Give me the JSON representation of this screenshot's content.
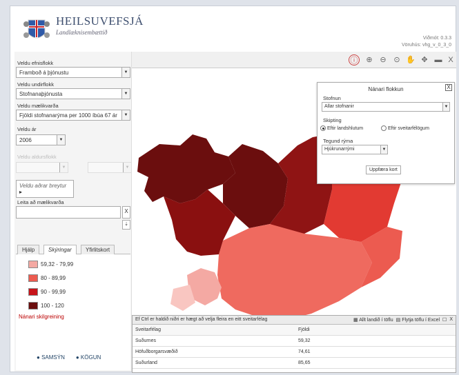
{
  "header": {
    "title": "HEILSUVEFSJÁ",
    "subtitle": "Landlæknisembættið",
    "version_line1": "Viðmót: 0.3.3",
    "version_line2": "Vöruhús: vhg_v_0_3_0"
  },
  "left": {
    "category_label": "Veldu efnisflokk",
    "category_value": "Framboð á þjónustu",
    "subcategory_label": "Veldu undirflokk",
    "subcategory_value": "Stofnanaþjónusta",
    "measure_label": "Veldu mælikvarða",
    "measure_value": "Fjöldi stofnanarýma per 1000 íbúa 67 ár",
    "year_label": "Veldu ár",
    "year_value": "2006",
    "age_label": "Veldu aldursflokk",
    "more_vars": "Veldu aðrar breytur",
    "search_label": "Leita að mælikvarða",
    "search_value": "",
    "tabs": [
      "Hjálp",
      "Skýringar",
      "Yfirlitskort"
    ],
    "legend": [
      {
        "label": "59,32 - 79,99",
        "color": "#f4a9a3"
      },
      {
        "label": "80 - 89,99",
        "color": "#ec5b50"
      },
      {
        "label": "90 - 99,99",
        "color": "#c8141a"
      },
      {
        "label": "100 - 120",
        "color": "#6b0e0e"
      }
    ],
    "nanari": "Nánari skilgreining",
    "footer_samsyn": "SAMSÝN",
    "footer_kogun": "KÖGUN"
  },
  "panel": {
    "title": "Nánari flokkun",
    "stofnun_label": "Stofnun",
    "stofnun_value": "Allar stofnanir",
    "skipting_label": "Skipting",
    "radio1": "Eftir landshlutum",
    "radio2": "Eftir sveitarfélögum",
    "tegund_label": "Tegund rýma",
    "tegund_value": "Hjúkrunarrými",
    "button": "Uppfæra kort"
  },
  "table": {
    "hint": "Ef Ctrl er haldið niðri er hægt að velja fleira en eitt sveitarfélag",
    "all_regions": "Allt landið í töflu",
    "export": "Flytja töflu í Excel",
    "col1": "Sveitarfélag",
    "col2": "Fjöldi",
    "rows": [
      {
        "name": "Suðurnes",
        "value": "59,32"
      },
      {
        "name": "Höfuðborgarsvæðið",
        "value": "74,61"
      },
      {
        "name": "Suðurland",
        "value": "85,65"
      }
    ]
  }
}
